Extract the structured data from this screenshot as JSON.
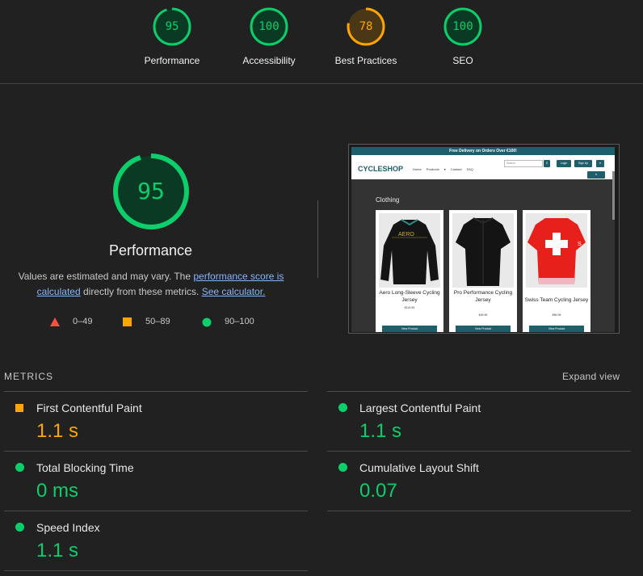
{
  "top_gauges": [
    {
      "score": "95",
      "label": "Performance",
      "status": "pass",
      "color": "#0cce6b"
    },
    {
      "score": "100",
      "label": "Accessibility",
      "status": "pass",
      "color": "#0cce6b"
    },
    {
      "score": "78",
      "label": "Best Practices",
      "status": "average",
      "color": "#ffa400"
    },
    {
      "score": "100",
      "label": "SEO",
      "status": "pass",
      "color": "#0cce6b"
    }
  ],
  "performance": {
    "score": "95",
    "score_fraction": 0.95,
    "title": "Performance",
    "note_prefix": "Values are estimated and may vary. The ",
    "note_link": "performance score is calculated",
    "note_middle": " directly from these metrics. ",
    "calculator_link": "See calculator."
  },
  "legend": [
    {
      "range": "0–49",
      "shape": "triangle",
      "color": "#ff4e42"
    },
    {
      "range": "50–89",
      "shape": "square",
      "color": "#ffa400"
    },
    {
      "range": "90–100",
      "shape": "circle",
      "color": "#0cce6b"
    }
  ],
  "screenshot": {
    "banner": "Free Delivery on Orders Over €100!",
    "logo": "CYCLESHOP",
    "nav_links": [
      "Home",
      "Products ▾",
      "Contact",
      "FAQ"
    ],
    "search_placeholder": "Search",
    "login": "Login",
    "signup": "Sign Up",
    "heading": "Clothing",
    "products": [
      {
        "name": "Aero Long-Sleeve Cycling Jersey",
        "price": "€119.99",
        "button": "View Product"
      },
      {
        "name": "Pro Performance Cycling Jersey",
        "price": "€49.99",
        "button": "View Product"
      },
      {
        "name": "Swiss Team Cycling Jersey",
        "price": "€89.99",
        "button": "View Product"
      }
    ]
  },
  "metrics": {
    "title": "METRICS",
    "expand_label": "Expand view",
    "items": [
      {
        "name": "First Contentful Paint",
        "value": "1.1 s",
        "status": "average",
        "color": "#ffa400"
      },
      {
        "name": "Largest Contentful Paint",
        "value": "1.1 s",
        "status": "pass",
        "color": "#0cce6b"
      },
      {
        "name": "Total Blocking Time",
        "value": "0 ms",
        "status": "pass",
        "color": "#0cce6b"
      },
      {
        "name": "Cumulative Layout Shift",
        "value": "0.07",
        "status": "pass",
        "color": "#0cce6b"
      },
      {
        "name": "Speed Index",
        "value": "1.1 s",
        "status": "pass",
        "color": "#0cce6b"
      }
    ]
  }
}
